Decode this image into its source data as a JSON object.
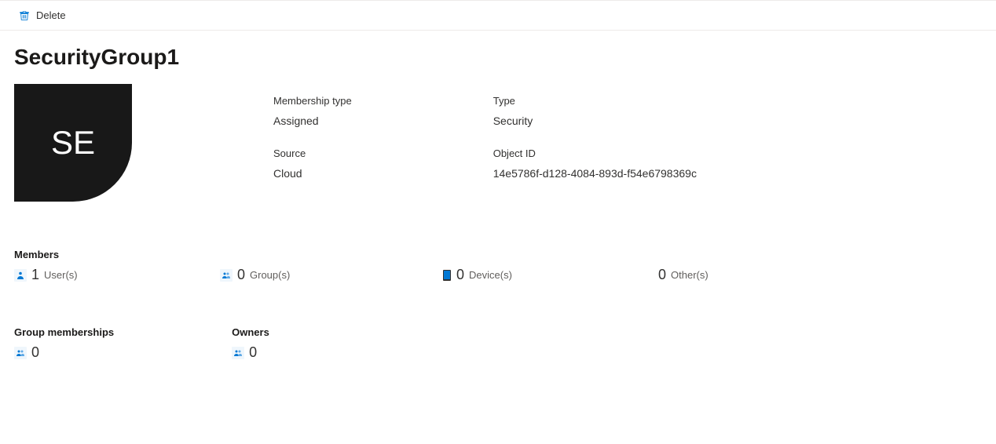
{
  "toolbar": {
    "delete_label": "Delete"
  },
  "page": {
    "title": "SecurityGroup1"
  },
  "avatar": {
    "initials": "SE"
  },
  "properties": {
    "membership_type_label": "Membership type",
    "membership_type_value": "Assigned",
    "source_label": "Source",
    "source_value": "Cloud",
    "type_label": "Type",
    "type_value": "Security",
    "object_id_label": "Object ID",
    "object_id_value": "14e5786f-d128-4084-893d-f54e6798369c"
  },
  "members": {
    "section_title": "Members",
    "users_count": "1",
    "users_label": "User(s)",
    "groups_count": "0",
    "groups_label": "Group(s)",
    "devices_count": "0",
    "devices_label": "Device(s)",
    "others_count": "0",
    "others_label": "Other(s)"
  },
  "group_memberships": {
    "section_title": "Group memberships",
    "count": "0"
  },
  "owners": {
    "section_title": "Owners",
    "count": "0"
  }
}
